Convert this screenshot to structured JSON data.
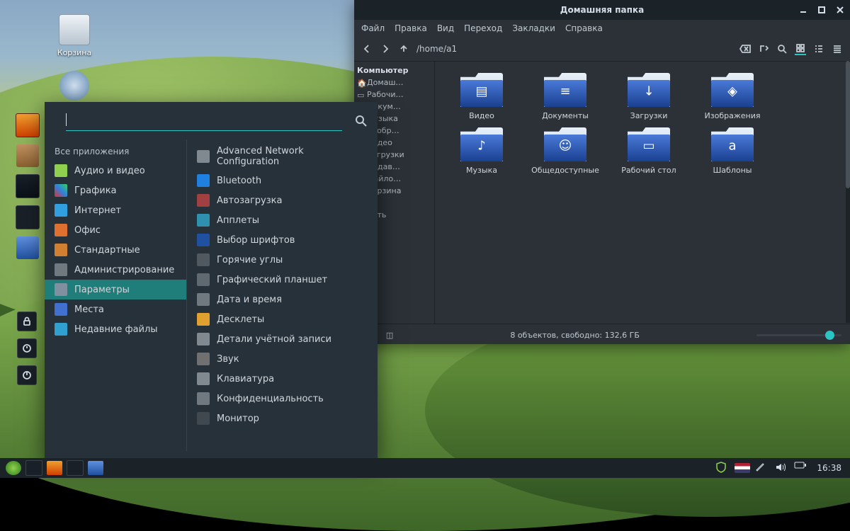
{
  "desktop": {
    "trash_label": "Корзина"
  },
  "appmenu": {
    "search_placeholder": "",
    "header": "Все приложения",
    "categories": [
      {
        "icon": "av",
        "label": "Аудио и видео"
      },
      {
        "icon": "gfx",
        "label": "Графика"
      },
      {
        "icon": "net",
        "label": "Интернет"
      },
      {
        "icon": "office",
        "label": "Офис"
      },
      {
        "icon": "std",
        "label": "Стандартные"
      },
      {
        "icon": "admin",
        "label": "Администрирование"
      },
      {
        "icon": "params",
        "label": "Параметры"
      },
      {
        "icon": "places",
        "label": "Места"
      },
      {
        "icon": "recent",
        "label": "Недавние файлы"
      }
    ],
    "apps": [
      {
        "icon": "net",
        "label": "Advanced Network Configuration"
      },
      {
        "icon": "bt",
        "label": "Bluetooth"
      },
      {
        "icon": "auto",
        "label": "Автозагрузка"
      },
      {
        "icon": "applet",
        "label": "Апплеты"
      },
      {
        "icon": "font",
        "label": "Выбор шрифтов"
      },
      {
        "icon": "corner",
        "label": "Горячие углы"
      },
      {
        "icon": "tablet",
        "label": "Графический планшет"
      },
      {
        "icon": "date",
        "label": "Дата и время"
      },
      {
        "icon": "desklet",
        "label": "Десклеты"
      },
      {
        "icon": "user",
        "label": "Детали учётной записи"
      },
      {
        "icon": "sound",
        "label": "Звук"
      },
      {
        "icon": "kbd",
        "label": "Клавиатура"
      },
      {
        "icon": "privacy",
        "label": "Конфиденциальность"
      },
      {
        "icon": "mon",
        "label": "Монитор"
      }
    ]
  },
  "fm": {
    "title": "Домашняя папка",
    "menu": [
      "Файл",
      "Правка",
      "Вид",
      "Переход",
      "Закладки",
      "Справка"
    ],
    "path": "/home/a1",
    "side_header": "Компьютер",
    "side": [
      "Домаш…",
      "Рабочи…",
      "Докум…",
      "Музыка",
      "Изобр…",
      "Видео",
      "Загрузки",
      "Недав…",
      "Файло…",
      "Корзина",
      "…",
      "Сеть"
    ],
    "folders": [
      {
        "sym": "film",
        "label": "Видео"
      },
      {
        "sym": "doc",
        "label": "Документы"
      },
      {
        "sym": "down",
        "label": "Загрузки"
      },
      {
        "sym": "img",
        "label": "Изображения"
      },
      {
        "sym": "music",
        "label": "Музыка"
      },
      {
        "sym": "share",
        "label": "Общедоступные"
      },
      {
        "sym": "desk",
        "label": "Рабочий стол"
      },
      {
        "sym": "tmpl",
        "label": "Шаблоны"
      }
    ],
    "status": "8 объектов, свободно: 132,6 ГБ"
  },
  "taskbar": {
    "clock": "16:38"
  }
}
